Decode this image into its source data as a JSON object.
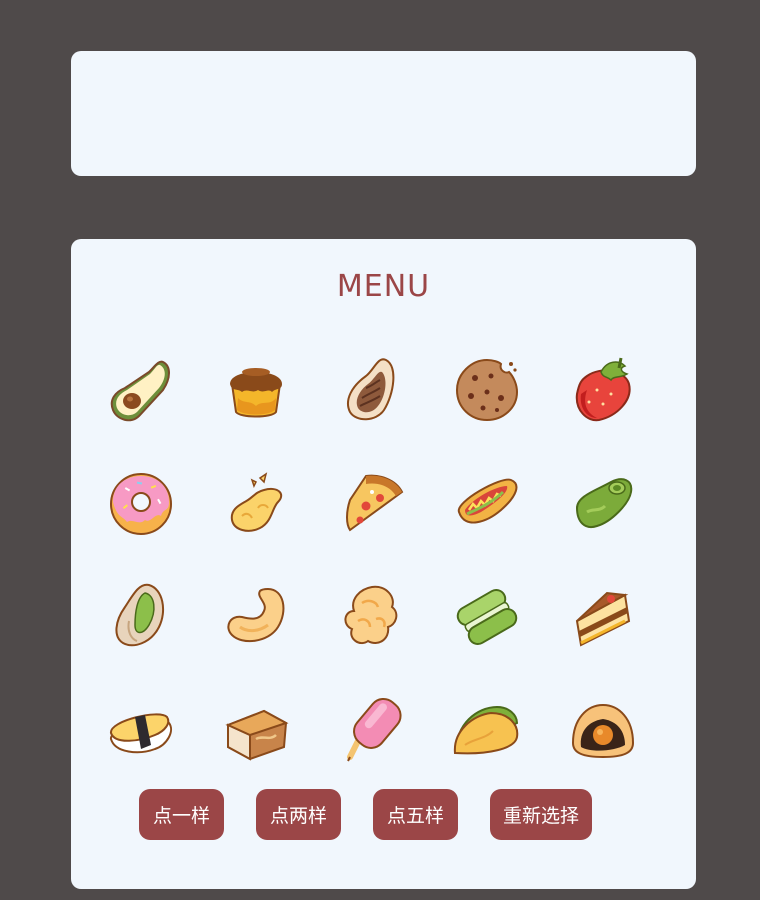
{
  "menu": {
    "title": "MENU",
    "foods": [
      {
        "icon": "avocado-icon"
      },
      {
        "icon": "pudding-icon"
      },
      {
        "icon": "pecan-icon"
      },
      {
        "icon": "cookie-icon"
      },
      {
        "icon": "strawberry-icon"
      },
      {
        "icon": "donut-icon"
      },
      {
        "icon": "potato-chip-icon"
      },
      {
        "icon": "pizza-slice-icon"
      },
      {
        "icon": "hot-dog-icon"
      },
      {
        "icon": "green-bean-icon"
      },
      {
        "icon": "pistachio-icon"
      },
      {
        "icon": "cashew-icon"
      },
      {
        "icon": "popcorn-icon"
      },
      {
        "icon": "macaron-icon"
      },
      {
        "icon": "cake-slice-icon"
      },
      {
        "icon": "tamagoyaki-sushi-icon"
      },
      {
        "icon": "bread-loaf-icon"
      },
      {
        "icon": "popsicle-icon"
      },
      {
        "icon": "taco-icon"
      },
      {
        "icon": "mochi-icon"
      }
    ]
  },
  "buttons": {
    "pick_one": "点一样",
    "pick_two": "点两样",
    "pick_five": "点五样",
    "reset": "重新选择"
  },
  "colors": {
    "background": "#4f4a4a",
    "panel": "#f1f7fd",
    "accent": "#9b4647"
  }
}
